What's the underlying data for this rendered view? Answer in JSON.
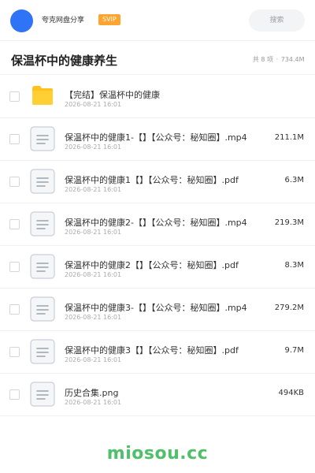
{
  "header": {
    "share_name": "夸克网盘分享",
    "badge": "SVIP",
    "search_placeholder": "搜索",
    "avatar_color": "#2f73f6",
    "badge_color": "#ffa42e"
  },
  "title_bar": {
    "title": "保温杯中的健康养生",
    "count_text": "共 8 项",
    "separator": "·",
    "total_size": "734.4M"
  },
  "files": [
    {
      "type": "folder",
      "name": "【完结】保温杯中的健康",
      "date": "2026-08-21 16:01",
      "size": ""
    },
    {
      "type": "file",
      "name": "保温杯中的健康1-【】【公众号：秘知圈】.mp4",
      "date": "2026-08-21 16:01",
      "size": "211.1M"
    },
    {
      "type": "file",
      "name": "保温杯中的健康1【】【公众号：秘知圈】.pdf",
      "date": "2026-08-21 16:01",
      "size": "6.3M"
    },
    {
      "type": "file",
      "name": "保温杯中的健康2-【】【公众号：秘知圈】.mp4",
      "date": "2026-08-21 16:01",
      "size": "219.3M"
    },
    {
      "type": "file",
      "name": "保温杯中的健康2【】【公众号：秘知圈】.pdf",
      "date": "2026-08-21 16:01",
      "size": "8.3M"
    },
    {
      "type": "file",
      "name": "保温杯中的健康3-【】【公众号：秘知圈】.mp4",
      "date": "2026-08-21 16:01",
      "size": "279.2M"
    },
    {
      "type": "file",
      "name": "保温杯中的健康3【】【公众号：秘知圈】.pdf",
      "date": "2026-08-21 16:01",
      "size": "9.7M"
    },
    {
      "type": "file",
      "name": "历史合集.png",
      "date": "2026-08-21 16:01",
      "size": "494KB"
    }
  ],
  "watermark": "miosou.cc"
}
